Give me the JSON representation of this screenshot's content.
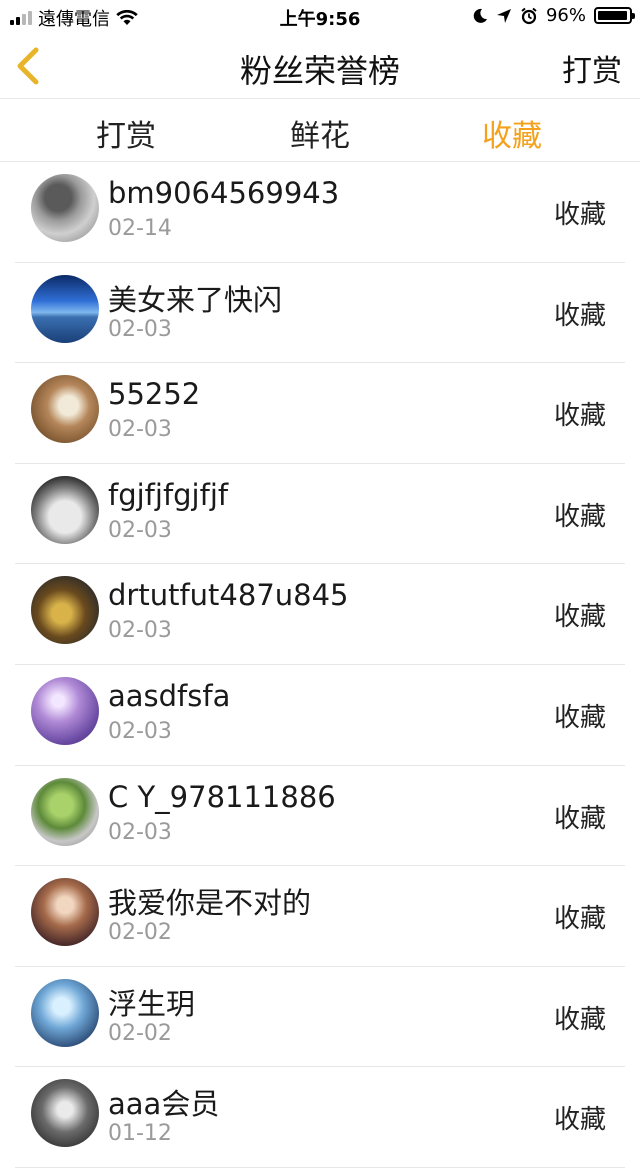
{
  "status_bar": {
    "carrier": "遠傳電信",
    "time": "上午9:56",
    "battery": "96%",
    "battery_level": 0.96,
    "icons": [
      "signal-icon",
      "wifi-icon",
      "moon-icon",
      "location-icon",
      "alarm-icon",
      "battery-icon"
    ]
  },
  "nav": {
    "back_icon": "chevron-left-icon",
    "title": "粉丝荣誉榜",
    "action_label": "打赏"
  },
  "tabs": [
    {
      "label": "打赏",
      "active": false
    },
    {
      "label": "鲜花",
      "active": false
    },
    {
      "label": "收藏",
      "active": true
    }
  ],
  "colors": {
    "accent": "#f4a11c",
    "back_icon": "#e8b52a",
    "date": "#9a9a9a",
    "divider": "#e6e6e6"
  },
  "list": [
    {
      "name": "bm9064569943",
      "date": "02-14",
      "action": "收藏"
    },
    {
      "name": "美女来了快闪",
      "date": "02-03",
      "action": "收藏"
    },
    {
      "name": "55252",
      "date": "02-03",
      "action": "收藏"
    },
    {
      "name": "fgjfjfgjfjf",
      "date": "02-03",
      "action": "收藏"
    },
    {
      "name": "drtutfut487u845",
      "date": "02-03",
      "action": "收藏"
    },
    {
      "name": "aasdfsfa",
      "date": "02-03",
      "action": "收藏"
    },
    {
      "name": "C Y_978111886",
      "date": "02-03",
      "action": "收藏"
    },
    {
      "name": "我爱你是不对的",
      "date": "02-02",
      "action": "收藏"
    },
    {
      "name": "浮生玥",
      "date": "02-02",
      "action": "收藏"
    },
    {
      "name": "aaa会员",
      "date": "01-12",
      "action": "收藏"
    }
  ]
}
